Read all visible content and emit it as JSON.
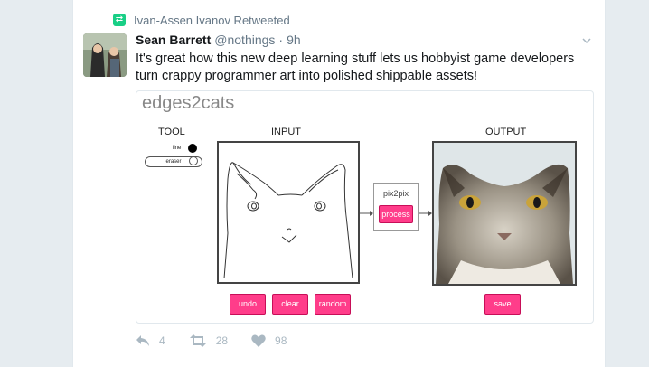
{
  "retweet_context": {
    "text": "Ivan-Assen Ivanov Retweeted",
    "icon": "retweet-icon",
    "accent": "#19cf86"
  },
  "tweet": {
    "name": "Sean Barrett",
    "handle": "@nothings",
    "separator": "·",
    "time": "9h",
    "text": "It's great how this new deep learning stuff lets us hobbyist game developers turn crappy programmer art into polished shippable assets!"
  },
  "app": {
    "title": "edges2cats",
    "tool_label": "TOOL",
    "input_label": "INPUT",
    "output_label": "OUTPUT",
    "line_label": "line",
    "eraser_label": "eraser",
    "model_label": "pix2pix",
    "buttons": {
      "process": "process",
      "undo": "undo",
      "clear": "clear",
      "random": "random",
      "save": "save"
    },
    "button_color": "#ff3d8a"
  },
  "actions": {
    "reply_count": "4",
    "retweet_count": "28",
    "like_count": "98"
  }
}
